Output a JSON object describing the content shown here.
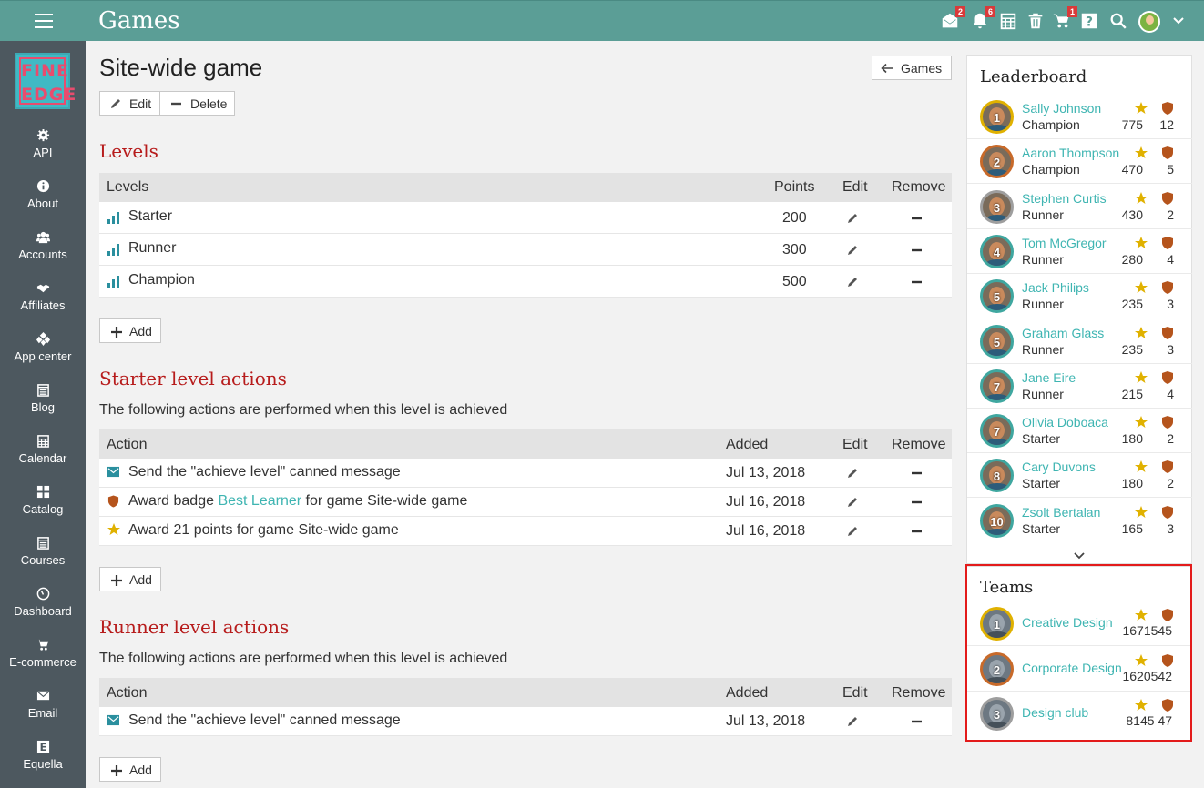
{
  "header": {
    "title": "Games",
    "icons": [
      {
        "name": "messages-icon",
        "badge": "2"
      },
      {
        "name": "notifications-icon",
        "badge": "6"
      },
      {
        "name": "calendar-icon",
        "badge": ""
      },
      {
        "name": "trash-icon",
        "badge": ""
      },
      {
        "name": "cart-icon",
        "badge": "1"
      },
      {
        "name": "help-icon",
        "badge": ""
      },
      {
        "name": "search-icon",
        "badge": ""
      }
    ]
  },
  "logo": {
    "line1": "FINE",
    "line2": "EDGE"
  },
  "sidebar": {
    "items": [
      {
        "label": "API",
        "icon": "gear-icon"
      },
      {
        "label": "About",
        "icon": "info-icon"
      },
      {
        "label": "Accounts",
        "icon": "users-icon"
      },
      {
        "label": "Affiliates",
        "icon": "handshake-icon"
      },
      {
        "label": "App center",
        "icon": "apps-icon"
      },
      {
        "label": "Blog",
        "icon": "blog-icon"
      },
      {
        "label": "Calendar",
        "icon": "calendar-icon"
      },
      {
        "label": "Catalog",
        "icon": "grid-icon"
      },
      {
        "label": "Courses",
        "icon": "courses-icon"
      },
      {
        "label": "Dashboard",
        "icon": "gauge-icon"
      },
      {
        "label": "E-commerce",
        "icon": "cart-icon"
      },
      {
        "label": "Email",
        "icon": "envelope-icon"
      },
      {
        "label": "Equella",
        "icon": "equella-icon"
      }
    ]
  },
  "page": {
    "title": "Site-wide game",
    "back_label": "Games",
    "edit_label": "Edit",
    "delete_label": "Delete",
    "add_label": "Add"
  },
  "levels": {
    "title": "Levels",
    "columns": [
      "Levels",
      "Points",
      "Edit",
      "Remove"
    ],
    "rows": [
      {
        "name": "Starter",
        "points": "200"
      },
      {
        "name": "Runner",
        "points": "300"
      },
      {
        "name": "Champion",
        "points": "500"
      }
    ]
  },
  "starter_actions": {
    "title": "Starter level actions",
    "description": "The following actions are performed when this level is achieved",
    "columns": [
      "Action",
      "Added",
      "Edit",
      "Remove"
    ],
    "rows": [
      {
        "icon": "envelope-icon",
        "pre": "Send the \"achieve level\" canned message",
        "link": "",
        "post": "",
        "added": "Jul 13, 2018"
      },
      {
        "icon": "badge-icon",
        "pre": "Award badge ",
        "link": "Best Learner",
        "post": " for game Site-wide game",
        "added": "Jul 16, 2018"
      },
      {
        "icon": "star-icon",
        "pre": "Award 21 points for game Site-wide game",
        "link": "",
        "post": "",
        "added": "Jul 16, 2018"
      }
    ]
  },
  "runner_actions": {
    "title": "Runner level actions",
    "description": "The following actions are performed when this level is achieved",
    "columns": [
      "Action",
      "Added",
      "Edit",
      "Remove"
    ],
    "rows": [
      {
        "icon": "envelope-icon",
        "pre": "Send the \"achieve level\" canned message",
        "link": "",
        "post": "",
        "added": "Jul 13, 2018"
      }
    ]
  },
  "leaderboard": {
    "title": "Leaderboard",
    "rows": [
      {
        "rank": "1",
        "name": "Sally Johnson",
        "level": "Champion",
        "points": "775",
        "badges": "12",
        "ring": "#e0b100"
      },
      {
        "rank": "2",
        "name": "Aaron Thompson",
        "level": "Champion",
        "points": "470",
        "badges": "5",
        "ring": "#c86a2a"
      },
      {
        "rank": "3",
        "name": "Stephen Curtis",
        "level": "Runner",
        "points": "430",
        "badges": "2",
        "ring": "#9e9e9e"
      },
      {
        "rank": "4",
        "name": "Tom McGregor",
        "level": "Runner",
        "points": "280",
        "badges": "4",
        "ring": "#3fa7a0"
      },
      {
        "rank": "5",
        "name": "Jack Philips",
        "level": "Runner",
        "points": "235",
        "badges": "3",
        "ring": "#3fa7a0"
      },
      {
        "rank": "5",
        "name": "Graham Glass",
        "level": "Runner",
        "points": "235",
        "badges": "3",
        "ring": "#3fa7a0"
      },
      {
        "rank": "7",
        "name": "Jane Eire",
        "level": "Runner",
        "points": "215",
        "badges": "4",
        "ring": "#3fa7a0"
      },
      {
        "rank": "7",
        "name": "Olivia Doboaca",
        "level": "Starter",
        "points": "180",
        "badges": "2",
        "ring": "#3fa7a0"
      },
      {
        "rank": "8",
        "name": "Cary Duvons",
        "level": "Starter",
        "points": "180",
        "badges": "2",
        "ring": "#3fa7a0"
      },
      {
        "rank": "10",
        "name": "Zsolt Bertalan",
        "level": "Starter",
        "points": "165",
        "badges": "3",
        "ring": "#3fa7a0"
      }
    ]
  },
  "teams": {
    "title": "Teams",
    "rows": [
      {
        "rank": "1",
        "name": "Creative Design",
        "points": "1671545",
        "ring": "#e0b100"
      },
      {
        "rank": "2",
        "name": "Corporate Design",
        "points": "1620542",
        "ring": "#c86a2a"
      },
      {
        "rank": "3",
        "name": "Design club",
        "points": "8145 47",
        "ring": "#9e9e9e"
      }
    ]
  },
  "colors": {
    "topbar": "#5b9e96",
    "sidebar": "#4d585f",
    "section_title": "#b71c1c",
    "link": "#3fb5b2",
    "star": "#e0b100",
    "badge": "#b5541c",
    "highlight": "#e31b1b"
  }
}
